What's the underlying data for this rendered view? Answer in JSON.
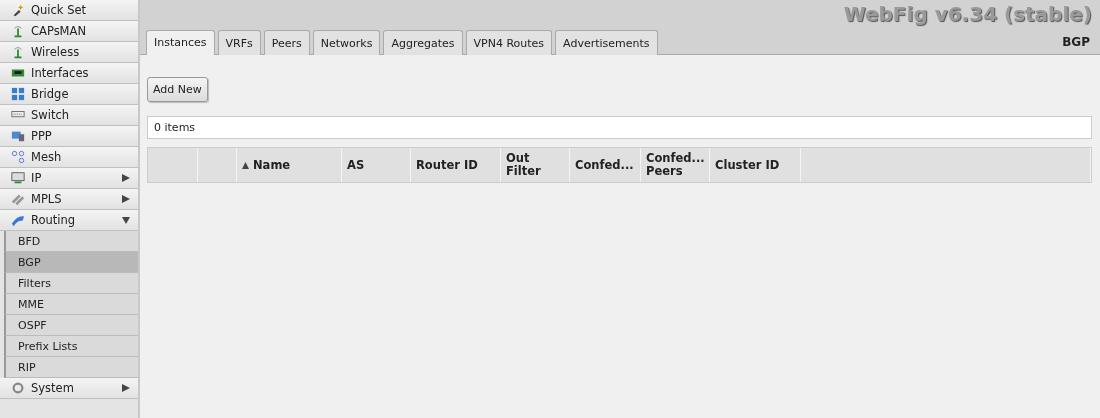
{
  "app_title": "WebFig v6.34 (stable)",
  "sidebar": {
    "items": [
      {
        "label": "Quick Set"
      },
      {
        "label": "CAPsMAN"
      },
      {
        "label": "Wireless"
      },
      {
        "label": "Interfaces"
      },
      {
        "label": "Bridge"
      },
      {
        "label": "Switch"
      },
      {
        "label": "PPP"
      },
      {
        "label": "Mesh"
      },
      {
        "label": "IP",
        "expanded": false
      },
      {
        "label": "MPLS",
        "expanded": false
      },
      {
        "label": "Routing",
        "expanded": true,
        "children": [
          {
            "label": "BFD",
            "selected": false
          },
          {
            "label": "BGP",
            "selected": true
          },
          {
            "label": "Filters",
            "selected": false
          },
          {
            "label": "MME",
            "selected": false
          },
          {
            "label": "OSPF",
            "selected": false
          },
          {
            "label": "Prefix Lists",
            "selected": false
          },
          {
            "label": "RIP",
            "selected": false
          }
        ]
      },
      {
        "label": "System",
        "expanded": false
      }
    ]
  },
  "tabs": [
    {
      "label": "Instances",
      "selected": true
    },
    {
      "label": "VRFs",
      "selected": false
    },
    {
      "label": "Peers",
      "selected": false
    },
    {
      "label": "Networks",
      "selected": false
    },
    {
      "label": "Aggregates",
      "selected": false
    },
    {
      "label": "VPN4 Routes",
      "selected": false
    },
    {
      "label": "Advertisements",
      "selected": false
    }
  ],
  "section_title": "BGP",
  "add_button": "Add New",
  "item_count": "0 items",
  "table": {
    "columns": [
      {
        "label": "Name",
        "sorted": true
      },
      {
        "label": "AS",
        "sorted": false
      },
      {
        "label": "Router ID",
        "sorted": false
      },
      {
        "label": "Out Filter",
        "sorted": false
      },
      {
        "label": "Confed...",
        "sorted": false
      },
      {
        "label": "Confed... Peers",
        "sorted": false
      },
      {
        "label": "Cluster ID",
        "sorted": false
      }
    ]
  }
}
